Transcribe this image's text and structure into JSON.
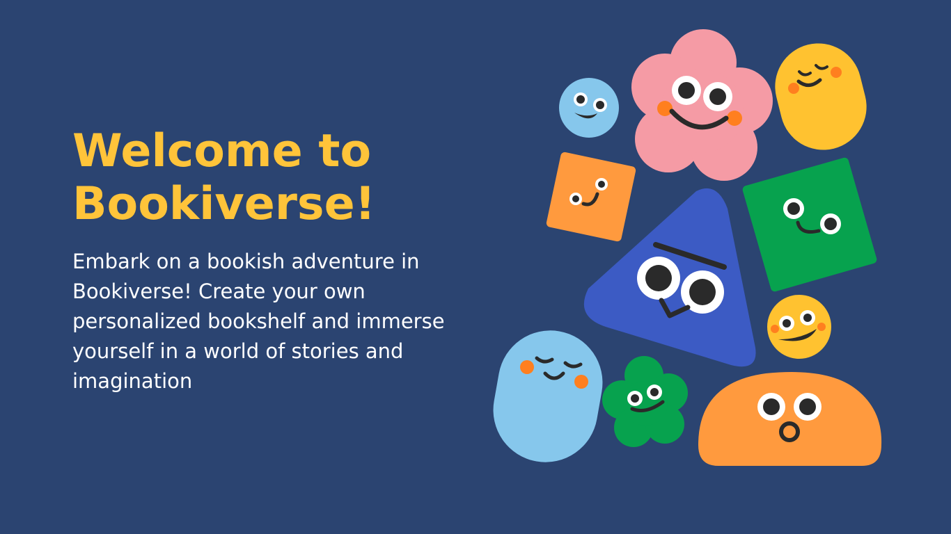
{
  "page": {
    "background_color": "#2b4471",
    "title_lines": [
      "Welcome to",
      "Bookiverse!"
    ],
    "title_color": "#ffc43a",
    "description": "Embark on a bookish adventure in Bookiverse! Create your own personalized bookshelf and immerse yourself in a world of stories and imagination",
    "description_color": "#ffffff"
  },
  "illustration": {
    "characters": [
      "blue-circle-character",
      "pink-flower-character",
      "yellow-pill-character",
      "orange-square-character",
      "blue-triangle-character",
      "green-square-character",
      "yellow-circle-character",
      "light-blue-pill-character",
      "green-clover-character",
      "orange-dome-character"
    ],
    "palette": {
      "pink": "#f59ba5",
      "yellow": "#ffc230",
      "orange": "#ff9a3e",
      "blue": "#3c5bc4",
      "green": "#07a24e",
      "light_blue": "#86c7ec",
      "face": "#2a2a2a",
      "cheek": "#ff7f1f"
    }
  }
}
